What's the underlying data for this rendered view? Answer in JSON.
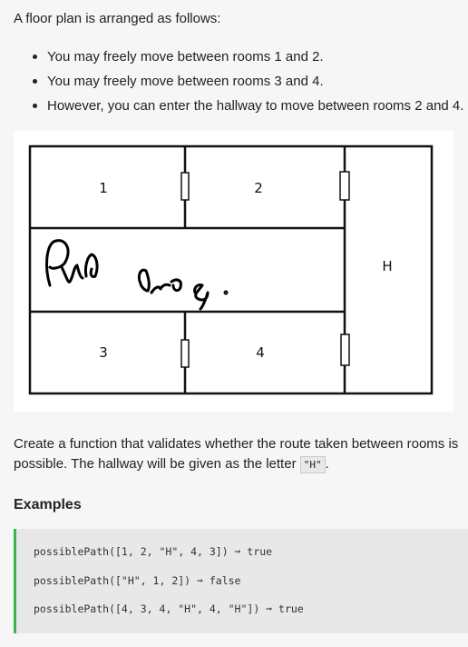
{
  "intro": "A floor plan is arranged as follows:",
  "rules": [
    "You may freely move between rooms 1 and 2.",
    "You may freely move between rooms 3 and 4.",
    "However, you can enter the hallway to move between rooms 2 and 4."
  ],
  "floor_plan": {
    "rooms": [
      "1",
      "2",
      "3",
      "4"
    ],
    "hallway_label": "H",
    "handwritten_note": "scribbled handwriting"
  },
  "description": {
    "text_before": "Create a function that validates whether the route taken between rooms is possible. The hallway will be given as the letter ",
    "code": "\"H\"",
    "text_after": "."
  },
  "examples": {
    "title": "Examples",
    "lines": [
      "possiblePath([1, 2, \"H\", 4, 3]) ➞ true",
      "possiblePath([\"H\", 1, 2]) ➞ false",
      "possiblePath([4, 3, 4, \"H\", 4, \"H\"]) ➞ true"
    ]
  },
  "colors": {
    "accent_border": "#3bb54a",
    "code_background": "#e8e8e8",
    "page_background": "#f6f6f6"
  }
}
